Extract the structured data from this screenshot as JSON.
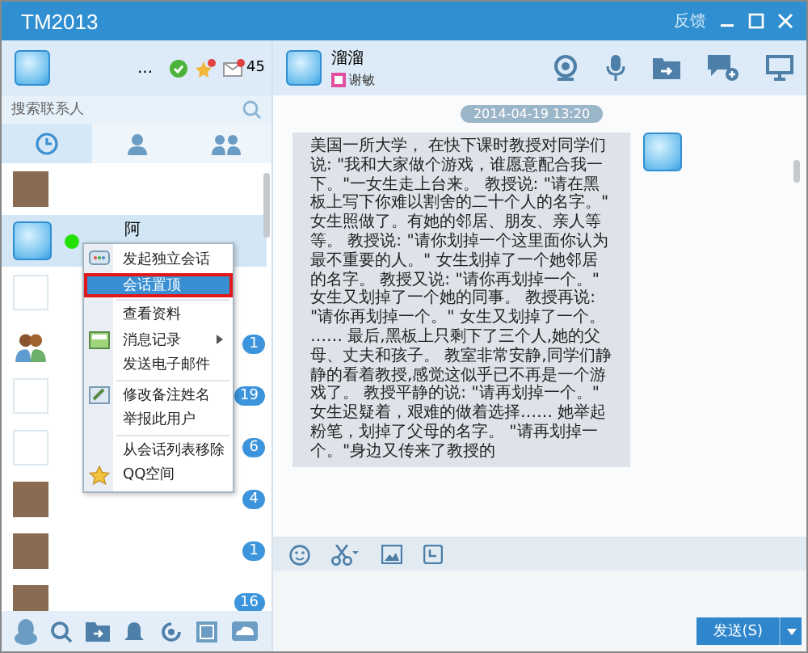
{
  "window": {
    "title": "TM2013",
    "feedback": "反馈"
  },
  "profile": {
    "name": "...",
    "mail_count": "45"
  },
  "search": {
    "placeholder": "搜索联系人"
  },
  "tabs": [
    {
      "kind": "recent",
      "selected": true
    },
    {
      "kind": "contacts",
      "selected": false
    },
    {
      "kind": "groups",
      "selected": false
    }
  ],
  "contacts": [
    {
      "kind": "photo",
      "online": false,
      "selected": false
    },
    {
      "kind": "default",
      "name": "阿",
      "online": true,
      "selected": true
    },
    {
      "kind": "blank",
      "online": false,
      "selected": false
    },
    {
      "kind": "people",
      "badge": "1",
      "online": false,
      "selected": false
    },
    {
      "kind": "blank",
      "badge": "19",
      "online": false,
      "selected": false
    },
    {
      "kind": "blank",
      "badge": "6",
      "online": false,
      "selected": false
    },
    {
      "kind": "photo",
      "badge": "4",
      "online": false,
      "selected": false
    },
    {
      "kind": "photo",
      "badge": "1",
      "online": false,
      "selected": false
    },
    {
      "kind": "photo",
      "badge": "16",
      "online": false,
      "selected": false
    }
  ],
  "context_menu": [
    {
      "label": "发起独立会话",
      "kind": "chat",
      "selected": false,
      "submenu": false,
      "separator_after": false
    },
    {
      "label": "会话置顶",
      "kind": "plain",
      "selected": true,
      "submenu": false,
      "separator_after": true
    },
    {
      "label": "查看资料",
      "kind": "plain",
      "selected": false,
      "submenu": false,
      "separator_after": false
    },
    {
      "label": "消息记录",
      "kind": "record",
      "selected": false,
      "submenu": true,
      "separator_after": false
    },
    {
      "label": "发送电子邮件",
      "kind": "plain",
      "selected": false,
      "submenu": false,
      "separator_after": true
    },
    {
      "label": "修改备注姓名",
      "kind": "edit",
      "selected": false,
      "submenu": false,
      "separator_after": false
    },
    {
      "label": "举报此用户",
      "kind": "plain",
      "selected": false,
      "submenu": false,
      "separator_after": true
    },
    {
      "label": "从会话列表移除",
      "kind": "plain",
      "selected": false,
      "submenu": false,
      "separator_after": false
    },
    {
      "label": "QQ空间",
      "kind": "star",
      "selected": false,
      "submenu": false,
      "separator_after": false
    }
  ],
  "chat": {
    "name": "溜溜",
    "subtitle": "谢敏",
    "timestamp": "2014-04-19 13:20",
    "message": "美国一所大学， 在快下课时教授对同学们说: \"我和大家做个游戏，谁愿意配合我一下。\"一女生走上台来。 教授说: \"请在黑板上写下你难以割舍的二十个人的名字。\" 女生照做了。有她的邻居、朋友、亲人等等。 教授说: \"请你划掉一个这里面你认为最不重要的人。\" 女生划掉了一个她邻居的名字。 教授又说: \"请你再划掉一个。\" 女生又划掉了一个她的同事。 教授再说: \"请你再划掉一个。\" 女生又划掉了一个。 …… 最后,黑板上只剩下了三个人,她的父母、丈夫和孩子。 教室非常安静,同学们静静的看着教授,感觉这似乎已不再是一个游戏了。 教授平静的说: \"请再划掉一个。\" 女生迟疑着，艰难的做着选择…… 她举起粉笔，划掉了父母的名字。 \"请再划掉一个。\"身边又传来了教授的"
  },
  "send_button": "发送(S)"
}
